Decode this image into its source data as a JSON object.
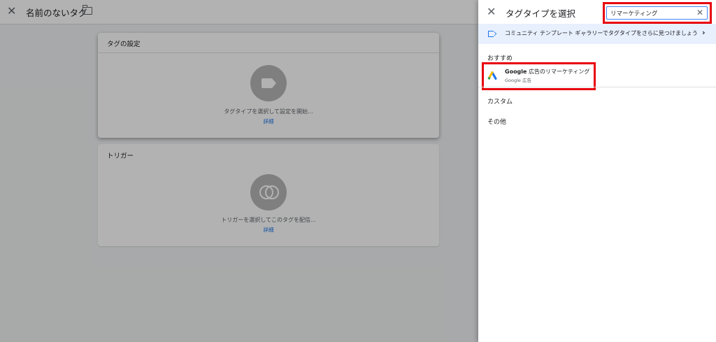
{
  "editor": {
    "title": "名前のないタグ",
    "tag_card": {
      "header": "タグの設定",
      "description": "タグタイプを選択して設定を開始...",
      "more_link": "詳細"
    },
    "trigger_card": {
      "header": "トリガー",
      "description": "トリガーを選択してこのタグを配信...",
      "more_link": "詳細"
    }
  },
  "panel": {
    "title": "タグタイプを選択",
    "search": {
      "value": "リマーケティング"
    },
    "banner": {
      "text": "コミュニティ テンプレート ギャラリーでタグタイプをさらに見つけましょう"
    },
    "sections": {
      "recommended": "おすすめ",
      "custom": "カスタム",
      "other": "その他"
    },
    "recommended_items": [
      {
        "brand": "Google",
        "name": "広告のリマーケティング",
        "subtitle": "Google 広告",
        "icon": "google-ads-icon"
      }
    ]
  },
  "colors": {
    "accent": "#1a73e8",
    "highlight": "#e8000b",
    "banner_bg": "#e8f0fe"
  }
}
